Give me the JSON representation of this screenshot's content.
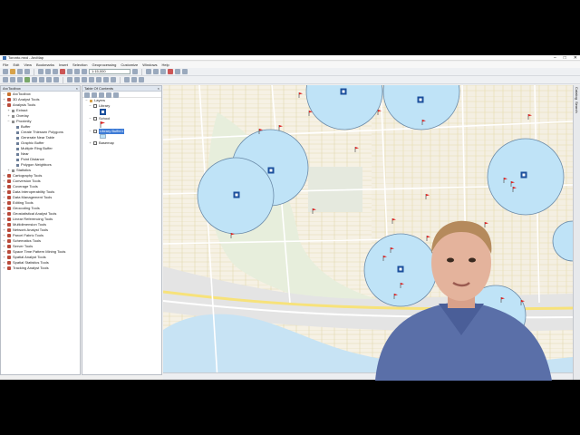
{
  "window": {
    "title": "Toronto.mxd - ArcMap",
    "controls": [
      "–",
      "□",
      "✕"
    ]
  },
  "menu": [
    "File",
    "Edit",
    "View",
    "Bookmarks",
    "Insert",
    "Selection",
    "Geoprocessing",
    "Customize",
    "Windows",
    "Help"
  ],
  "toolbar": {
    "scale_value": "1:15,000"
  },
  "toolbox": {
    "title": "ArcToolbox",
    "items": [
      {
        "label": "ArcToolbox",
        "level": 0,
        "type": "root"
      },
      {
        "label": "3D Analyst Tools",
        "level": 0,
        "type": "toolbox"
      },
      {
        "label": "Analysis Tools",
        "level": 0,
        "type": "toolbox"
      },
      {
        "label": "Extract",
        "level": 1,
        "type": "toolset"
      },
      {
        "label": "Overlay",
        "level": 1,
        "type": "toolset"
      },
      {
        "label": "Proximity",
        "level": 1,
        "type": "toolset"
      },
      {
        "label": "Buffer",
        "level": 2,
        "type": "tool"
      },
      {
        "label": "Create Thiessen Polygons",
        "level": 2,
        "type": "tool"
      },
      {
        "label": "Generate Near Table",
        "level": 2,
        "type": "tool"
      },
      {
        "label": "Graphic Buffer",
        "level": 2,
        "type": "tool"
      },
      {
        "label": "Multiple Ring Buffer",
        "level": 2,
        "type": "tool"
      },
      {
        "label": "Near",
        "level": 2,
        "type": "tool"
      },
      {
        "label": "Point Distance",
        "level": 2,
        "type": "tool"
      },
      {
        "label": "Polygon Neighbors",
        "level": 2,
        "type": "tool"
      },
      {
        "label": "Statistics",
        "level": 1,
        "type": "toolset"
      },
      {
        "label": "Cartography Tools",
        "level": 0,
        "type": "toolbox"
      },
      {
        "label": "Conversion Tools",
        "level": 0,
        "type": "toolbox"
      },
      {
        "label": "Coverage Tools",
        "level": 0,
        "type": "toolbox"
      },
      {
        "label": "Data Interoperability Tools",
        "level": 0,
        "type": "toolbox"
      },
      {
        "label": "Data Management Tools",
        "level": 0,
        "type": "toolbox"
      },
      {
        "label": "Editing Tools",
        "level": 0,
        "type": "toolbox"
      },
      {
        "label": "Geocoding Tools",
        "level": 0,
        "type": "toolbox"
      },
      {
        "label": "Geostatistical Analyst Tools",
        "level": 0,
        "type": "toolbox"
      },
      {
        "label": "Linear Referencing Tools",
        "level": 0,
        "type": "toolbox"
      },
      {
        "label": "Multidimension Tools",
        "level": 0,
        "type": "toolbox"
      },
      {
        "label": "Network Analyst Tools",
        "level": 0,
        "type": "toolbox"
      },
      {
        "label": "Parcel Fabric Tools",
        "level": 0,
        "type": "toolbox"
      },
      {
        "label": "Schematics Tools",
        "level": 0,
        "type": "toolbox"
      },
      {
        "label": "Server Tools",
        "level": 0,
        "type": "toolbox"
      },
      {
        "label": "Space Time Pattern Mining Tools",
        "level": 0,
        "type": "toolbox"
      },
      {
        "label": "Spatial Analyst Tools",
        "level": 0,
        "type": "toolbox"
      },
      {
        "label": "Spatial Statistics Tools",
        "level": 0,
        "type": "toolbox"
      },
      {
        "label": "Tracking Analyst Tools",
        "level": 0,
        "type": "toolbox"
      }
    ]
  },
  "toc": {
    "title": "Table Of Contents",
    "layers_label": "Layers",
    "layers": [
      {
        "label": "Library",
        "symbol": "library-icon",
        "selected": false
      },
      {
        "label": "School",
        "symbol": "flag-icon",
        "selected": false
      },
      {
        "label": "Library Buffer1",
        "symbol": "buffer-swatch",
        "selected": true
      },
      {
        "label": "Basemap",
        "symbol": "none",
        "selected": false
      }
    ]
  },
  "right_strip": [
    "Catalog",
    "Search"
  ],
  "colors": {
    "buffer_fill": "#bfe3f7",
    "buffer_stroke": "#6a8aa8",
    "school_flag": "#d22",
    "library_blue": "#1b4f9c"
  }
}
